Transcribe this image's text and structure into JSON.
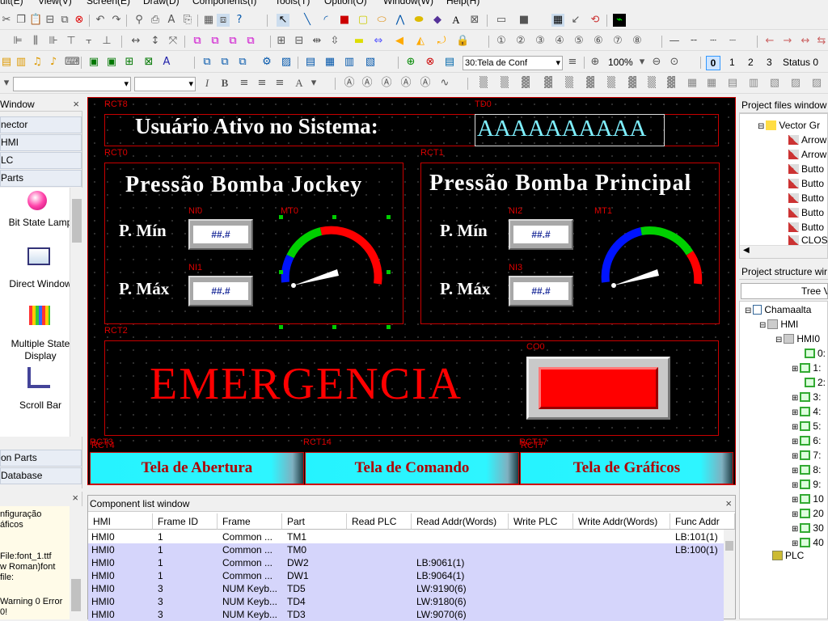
{
  "menu": [
    "uit(E)",
    "View(V)",
    "Screen(E)",
    "Draw(D)",
    "Components(I)",
    "Tools(T)",
    "Option(O)",
    "Window(W)",
    "Help(H)"
  ],
  "toolbar": {
    "screen_dropdown": "30:Tela de Conf",
    "zoom": "100%",
    "state_buttons": [
      "0",
      "1",
      "2",
      "3"
    ],
    "status_label": "Status 0"
  },
  "left": {
    "window_title": "Window",
    "categories": [
      "nector",
      "HMI",
      "LC",
      " Parts"
    ],
    "parts": [
      {
        "label": "Bit State Lamp"
      },
      {
        "label": "Direct Window"
      },
      {
        "label": "Multiple State Display"
      },
      {
        "label": "Scroll Bar"
      }
    ],
    "bottom_tabs": [
      "on Parts",
      "Database"
    ],
    "output_lines": [
      "nfiguração",
      "áficos",
      "",
      "",
      "File:font_1.ttf",
      "w Roman)font file:",
      "",
      "Warning 0 Error 0!"
    ]
  },
  "editor": {
    "rct8": "RCT8",
    "td0": "TD0",
    "title_text": "Usuário Ativo no Sistema:",
    "td0_value": "AAAAAAAAAA",
    "rct0": "RCT0",
    "rct1": "RCT1",
    "rct2": "RCT2",
    "left_panel_title": "Pressão Bomba Jockey",
    "right_panel_title": "Pressão Bomba Principal",
    "pmin": "P. Mín",
    "pmax": "P. Máx",
    "ni0": "NI0",
    "ni1": "NI1",
    "ni2": "NI2",
    "ni3": "NI3",
    "num_placeholder": "##.#",
    "mt0": "MT0",
    "mt1": "MT1",
    "emergency": "EMERGENCIA",
    "co0": "CO0",
    "rct3": "RCT3",
    "rct4": "RCT4",
    "rct14": "RCT14",
    "rct17": "RCT17",
    "rct7": "RCT7",
    "nav": [
      "Tela de Abertura",
      "Tela de Comando",
      "Tela de Gráficos"
    ]
  },
  "right": {
    "files_title": "Project files window",
    "files_root": "Vector Gr",
    "files_items": [
      "Arrow",
      "Arrow",
      "Butto",
      "Butto",
      "Butto",
      "Butto",
      "Butto",
      "CLOS"
    ],
    "structure_title": "Project structure wir",
    "tree_view_button": "Tree Vi",
    "tree_root": "Chamaalta",
    "tree_hmi": "HMI",
    "tree_hmi0": "HMI0",
    "tree_frames": [
      "0:",
      "1:",
      "2:",
      "3:",
      "4:",
      "5:",
      "6:",
      "7:",
      "8:",
      "9:",
      "10",
      "20",
      "30",
      "40"
    ],
    "tree_plc": "PLC"
  },
  "complist": {
    "title": "Component list window",
    "headers": [
      "HMI",
      "Frame ID",
      "Frame",
      "Part",
      "Read PLC",
      "Read Addr(Words)",
      "Write PLC",
      "Write Addr(Words)",
      "Func Addr"
    ],
    "rows": [
      [
        "HMI0",
        "1",
        "Common ...",
        "TM1",
        "",
        "",
        "",
        "",
        "LB:101(1)"
      ],
      [
        "HMI0",
        "1",
        "Common ...",
        "TM0",
        "",
        "",
        "",
        "",
        "LB:100(1)"
      ],
      [
        "HMI0",
        "1",
        "Common ...",
        "DW2",
        "",
        "LB:9061(1)",
        "",
        "",
        ""
      ],
      [
        "HMI0",
        "1",
        "Common ...",
        "DW1",
        "",
        "LB:9064(1)",
        "",
        "",
        ""
      ],
      [
        "HMI0",
        "3",
        "NUM Keyb...",
        "TD5",
        "",
        "LW:9190(6)",
        "",
        "",
        ""
      ],
      [
        "HMI0",
        "3",
        "NUM Keyb...",
        "TD4",
        "",
        "LW:9180(6)",
        "",
        "",
        ""
      ],
      [
        "HMI0",
        "3",
        "NUM Keyb...",
        "TD3",
        "",
        "LW:9070(6)",
        "",
        "",
        ""
      ]
    ]
  }
}
